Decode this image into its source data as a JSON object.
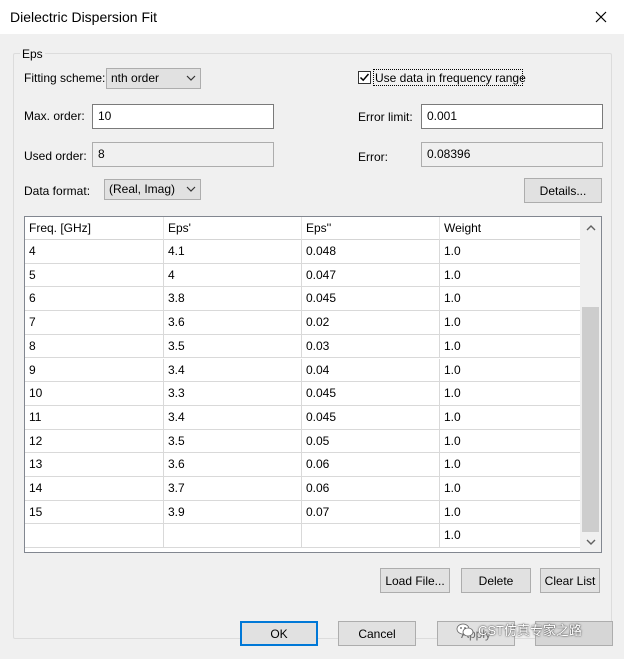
{
  "window": {
    "title": "Dielectric Dispersion Fit"
  },
  "group": {
    "label": "Eps"
  },
  "fitting_scheme": {
    "label": "Fitting scheme:",
    "value": "nth order"
  },
  "use_data_range": {
    "label": "Use data in frequency range",
    "checked": true
  },
  "max_order": {
    "label": "Max. order:",
    "value": "10"
  },
  "error_limit": {
    "label": "Error limit:",
    "value": "0.001"
  },
  "used_order": {
    "label": "Used order:",
    "value": "8"
  },
  "error": {
    "label": "Error:",
    "value": "0.08396"
  },
  "data_format": {
    "label": "Data format:",
    "value": "(Real, Imag)"
  },
  "details_button": "Details...",
  "table": {
    "columns": [
      "Freq. [GHz]",
      "Eps'",
      "Eps''",
      "Weight"
    ],
    "rows": [
      [
        "4",
        "4.1",
        "0.048",
        "1.0"
      ],
      [
        "5",
        "4",
        "0.047",
        "1.0"
      ],
      [
        "6",
        "3.8",
        "0.045",
        "1.0"
      ],
      [
        "7",
        "3.6",
        "0.02",
        "1.0"
      ],
      [
        "8",
        "3.5",
        "0.03",
        "1.0"
      ],
      [
        "9",
        "3.4",
        "0.04",
        "1.0"
      ],
      [
        "10",
        "3.3",
        "0.045",
        "1.0"
      ],
      [
        "11",
        "3.4",
        "0.045",
        "1.0"
      ],
      [
        "12",
        "3.5",
        "0.05",
        "1.0"
      ],
      [
        "13",
        "3.6",
        "0.06",
        "1.0"
      ],
      [
        "14",
        "3.7",
        "0.06",
        "1.0"
      ],
      [
        "15",
        "3.9",
        "0.07",
        "1.0"
      ],
      [
        "",
        "",
        "",
        "1.0"
      ]
    ]
  },
  "buttons": {
    "load_file": "Load File...",
    "delete": "Delete",
    "clear_list": "Clear List",
    "ok": "OK",
    "cancel": "Cancel",
    "apply": "Apply"
  },
  "watermark": {
    "text": "CST仿真专家之路"
  },
  "icons": {
    "close": "close-icon",
    "dropdown": "chevron-down-icon",
    "checkmark": "checkmark-icon",
    "scroll_up": "scroll-up-icon",
    "scroll_down": "scroll-down-icon",
    "wechat": "wechat-icon"
  }
}
